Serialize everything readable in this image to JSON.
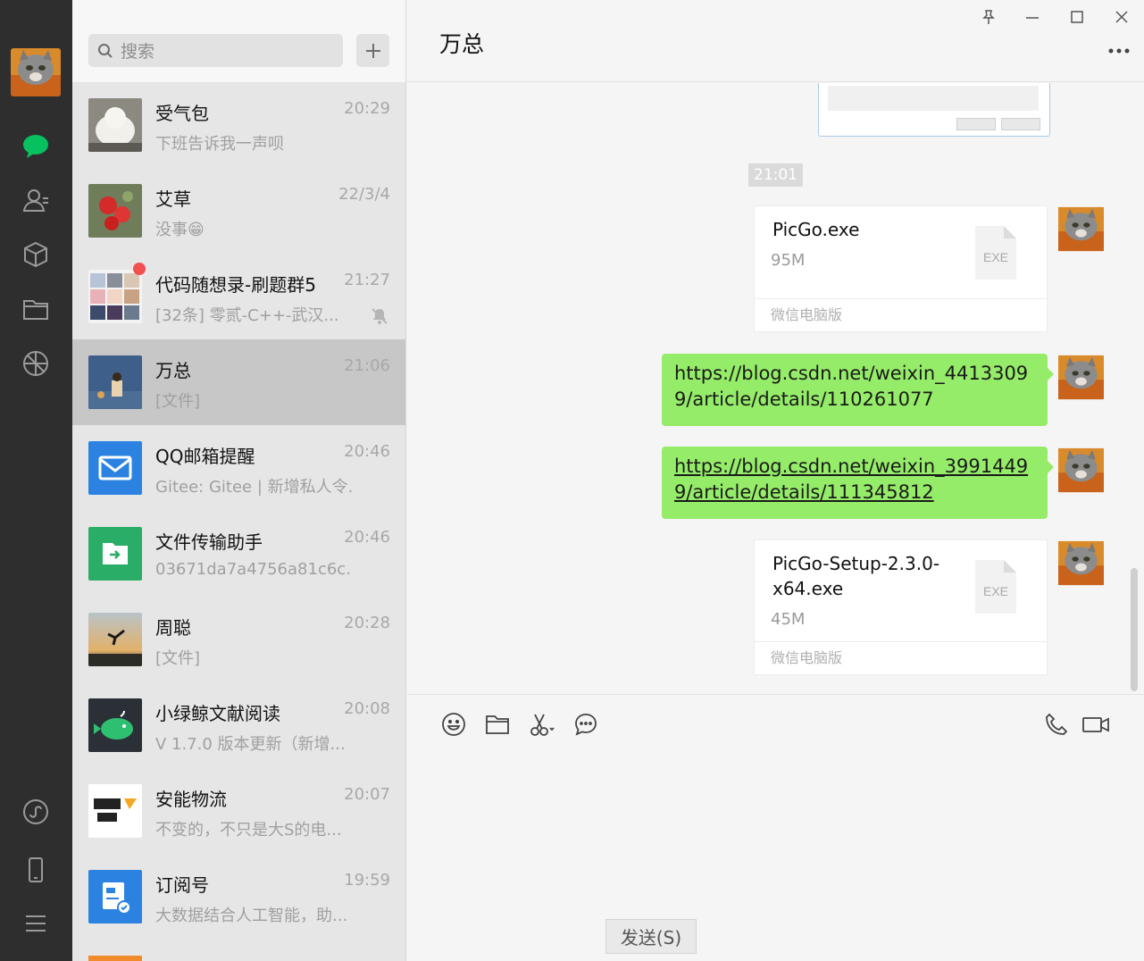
{
  "search": {
    "placeholder": "搜索"
  },
  "chats": [
    {
      "name": "受气包",
      "time": "20:29",
      "preview": "下班告诉我一声呗"
    },
    {
      "name": "艾草",
      "time": "22/3/4",
      "preview": "没事😁"
    },
    {
      "name": "代码随想录-刷题群5",
      "time": "21:27",
      "preview": "[32条] 零贰-C++-武汉...",
      "unread": true,
      "muted": true
    },
    {
      "name": "万总",
      "time": "21:06",
      "preview": "[文件]",
      "active": true
    },
    {
      "name": "QQ邮箱提醒",
      "time": "20:46",
      "preview": "Gitee: Gitee | 新增私人令..."
    },
    {
      "name": "文件传输助手",
      "time": "20:46",
      "preview": "03671da7a4756a81c6c..."
    },
    {
      "name": "周聪",
      "time": "20:28",
      "preview": "[文件]"
    },
    {
      "name": "小绿鲸文献阅读",
      "time": "20:08",
      "preview": "V 1.7.0 版本更新（新增..."
    },
    {
      "name": "安能物流",
      "time": "20:07",
      "preview": "不变的，不只是大S的电..."
    },
    {
      "name": "订阅号",
      "time": "19:59",
      "preview": "大数据结合人工智能，助..."
    }
  ],
  "conversation": {
    "title": "万总",
    "timestamp": "21:01",
    "messages": [
      {
        "type": "file",
        "name": "PicGo.exe",
        "size": "95M",
        "ext": "EXE",
        "source": "微信电脑版"
      },
      {
        "type": "link",
        "text": "https://blog.csdn.net/weixin_44133099/article/details/110261077"
      },
      {
        "type": "link",
        "text": "https://blog.csdn.net/weixin_39914499/article/details/111345812"
      },
      {
        "type": "file",
        "name": "PicGo-Setup-2.3.0-x64.exe",
        "size": "45M",
        "ext": "EXE",
        "source": "微信电脑版"
      }
    ]
  },
  "composer": {
    "send_label": "发送(S)"
  },
  "colors": {
    "accent_green": "#07c160",
    "bubble_green": "#95ec69",
    "rail_bg": "#2e2e2e",
    "unread_red": "#f24f4f"
  },
  "icons": {
    "rail": [
      "chat-icon",
      "contacts-icon",
      "favorites-icon",
      "files-icon",
      "moments-icon",
      "miniprogram-icon",
      "phone-icon",
      "menu-icon"
    ],
    "window": [
      "pin-icon",
      "minimize-icon",
      "maximize-icon",
      "close-icon",
      "more-icon"
    ],
    "toolbar": [
      "emoji-icon",
      "folder-icon",
      "screenshot-icon",
      "chat-history-icon",
      "voice-call-icon",
      "video-call-icon"
    ]
  }
}
